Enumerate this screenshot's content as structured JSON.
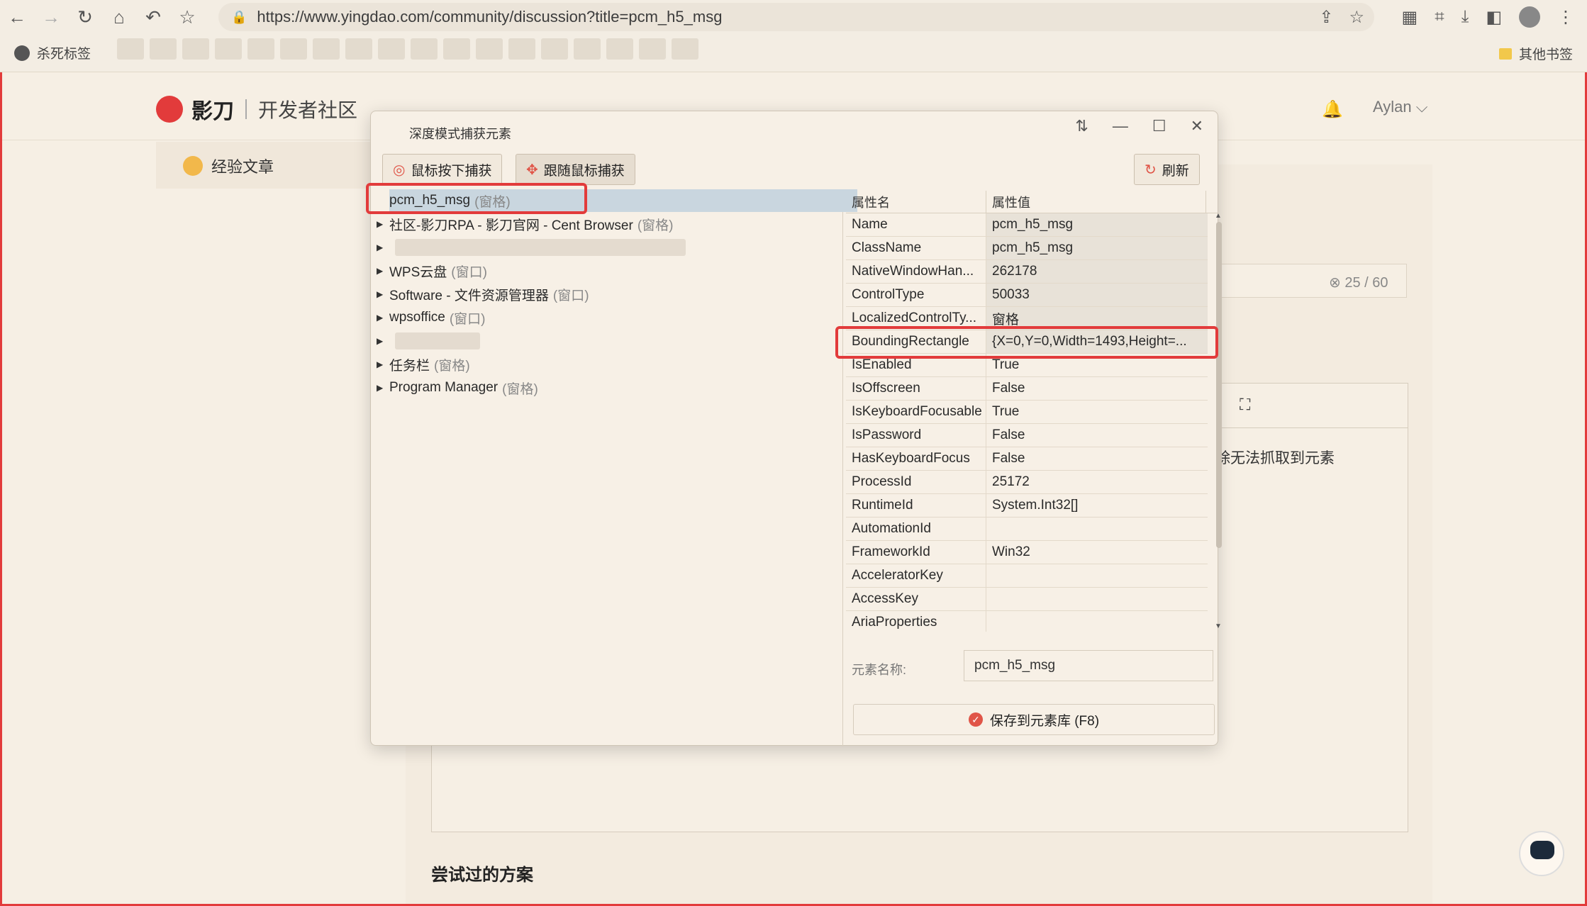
{
  "browser": {
    "url": "https://www.yingdao.com/community/discussion?title=pcm_h5_msg",
    "bookmark_first": "杀死标签",
    "bookmark_other": "其他书签"
  },
  "site": {
    "brand": "影刀",
    "subtitle": "开发者社区",
    "user_name": "Aylan",
    "sidebar_item": "经验文章",
    "char_count": "25 / 60",
    "editor_text": "除无法抓取到元素",
    "tried_heading": "尝试过的方案"
  },
  "dialog": {
    "title": "深度模式捕获元素",
    "btn_mouse_down": "鼠标按下捕获",
    "btn_follow_mouse": "跟随鼠标捕获",
    "btn_refresh": "刷新",
    "tree": [
      {
        "label": "pcm_h5_msg",
        "tag": "(窗格)",
        "selected": true
      },
      {
        "label": "社区-影刀RPA - 影刀官网 - Cent Browser",
        "tag": "(窗格)"
      },
      {
        "label": "",
        "tag": ""
      },
      {
        "label": "WPS云盘",
        "tag": "(窗口)"
      },
      {
        "label": "Software - 文件资源管理器",
        "tag": "(窗口)"
      },
      {
        "label": "wpsoffice",
        "tag": "(窗口)"
      },
      {
        "label": "",
        "tag": ""
      },
      {
        "label": "任务栏",
        "tag": "(窗格)"
      },
      {
        "label": "Program Manager",
        "tag": "(窗格)"
      }
    ],
    "prop_header_name": "属性名",
    "prop_header_value": "属性值",
    "props": [
      {
        "name": "Name",
        "value": "pcm_h5_msg"
      },
      {
        "name": "ClassName",
        "value": "pcm_h5_msg"
      },
      {
        "name": "NativeWindowHan...",
        "value": "262178"
      },
      {
        "name": "ControlType",
        "value": "50033"
      },
      {
        "name": "LocalizedControlTy...",
        "value": "窗格"
      },
      {
        "name": "BoundingRectangle",
        "value": "{X=0,Y=0,Width=1493,Height=..."
      },
      {
        "name": "IsEnabled",
        "value": "True"
      },
      {
        "name": "IsOffscreen",
        "value": "False"
      },
      {
        "name": "IsKeyboardFocusable",
        "value": "True"
      },
      {
        "name": "IsPassword",
        "value": "False"
      },
      {
        "name": "HasKeyboardFocus",
        "value": "False"
      },
      {
        "name": "ProcessId",
        "value": "25172"
      },
      {
        "name": "RuntimeId",
        "value": "System.Int32[]"
      },
      {
        "name": "AutomationId",
        "value": ""
      },
      {
        "name": "FrameworkId",
        "value": "Win32"
      },
      {
        "name": "AcceleratorKey",
        "value": ""
      },
      {
        "name": "AccessKey",
        "value": ""
      },
      {
        "name": "AriaProperties",
        "value": ""
      }
    ],
    "element_name_label": "元素名称:",
    "element_name_value": "pcm_h5_msg",
    "save_label": "保存到元素库 (F8)"
  },
  "colors": {
    "highlight_red": "#e23b3b",
    "accent": "#e05548"
  }
}
